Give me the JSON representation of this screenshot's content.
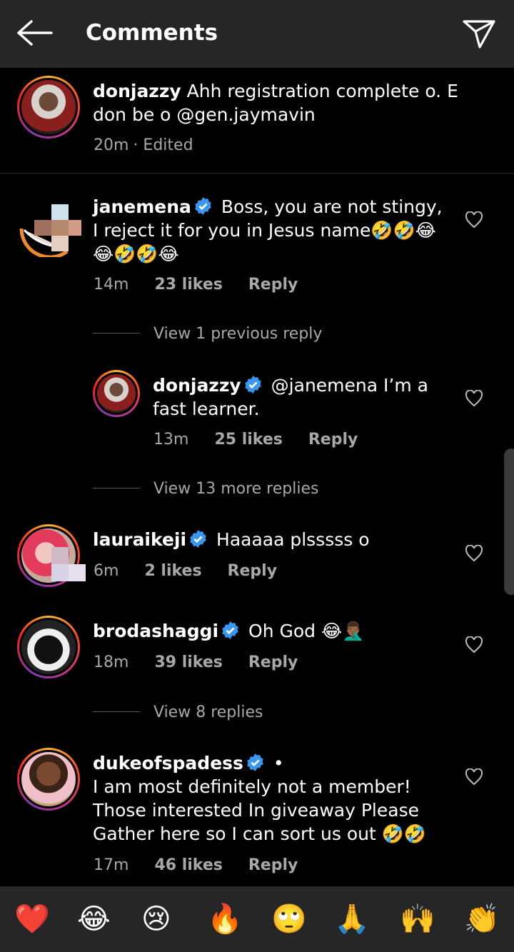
{
  "header": {
    "title": "Comments"
  },
  "caption": {
    "username": "donjazzy",
    "text": "Ahh registration complete o. E don be o @gen.jaymavin",
    "time": "20m",
    "edited": "· Edited"
  },
  "comments": [
    {
      "username": "janemena",
      "text": "Boss, you are not stingy, I reject it for you in Jesus name🤣🤣😂😂🤣🤣😂",
      "time": "14m",
      "likes": "23 likes",
      "reply": "Reply",
      "view_replies": "View 1 previous reply"
    },
    {
      "username": "donjazzy",
      "text": "@janemena I’m a fast learner.",
      "time": "13m",
      "likes": "25 likes",
      "reply": "Reply",
      "view_replies": "View 13 more replies"
    },
    {
      "username": "lauraikeji",
      "text": "Haaaaa plsssss o",
      "time": "6m",
      "likes": "2 likes",
      "reply": "Reply"
    },
    {
      "username": "brodashaggi",
      "text": "Oh God 😂🤦🏾‍♂️",
      "time": "18m",
      "likes": "39 likes",
      "reply": "Reply",
      "view_replies": "View 8 replies"
    },
    {
      "username": "dukeofspadess",
      "dot": "•",
      "text": "I am most definitely not a member! Those interested In giveaway Please Gather here so I can sort us out 🤣🤣",
      "time": "17m",
      "likes": "46 likes",
      "reply": "Reply"
    }
  ],
  "emoji_bar": [
    "❤️",
    "😂",
    "😢",
    "🔥",
    "🙄",
    "🙏",
    "🙌",
    "👏"
  ],
  "icons": {
    "back": "arrow-left-icon",
    "send": "send-icon",
    "heart": "heart-outline-icon",
    "verified": "verified-badge-icon"
  },
  "colors": {
    "header_bg": "#262626",
    "verified": "#3897f0",
    "muted": "#a8a8a8"
  }
}
